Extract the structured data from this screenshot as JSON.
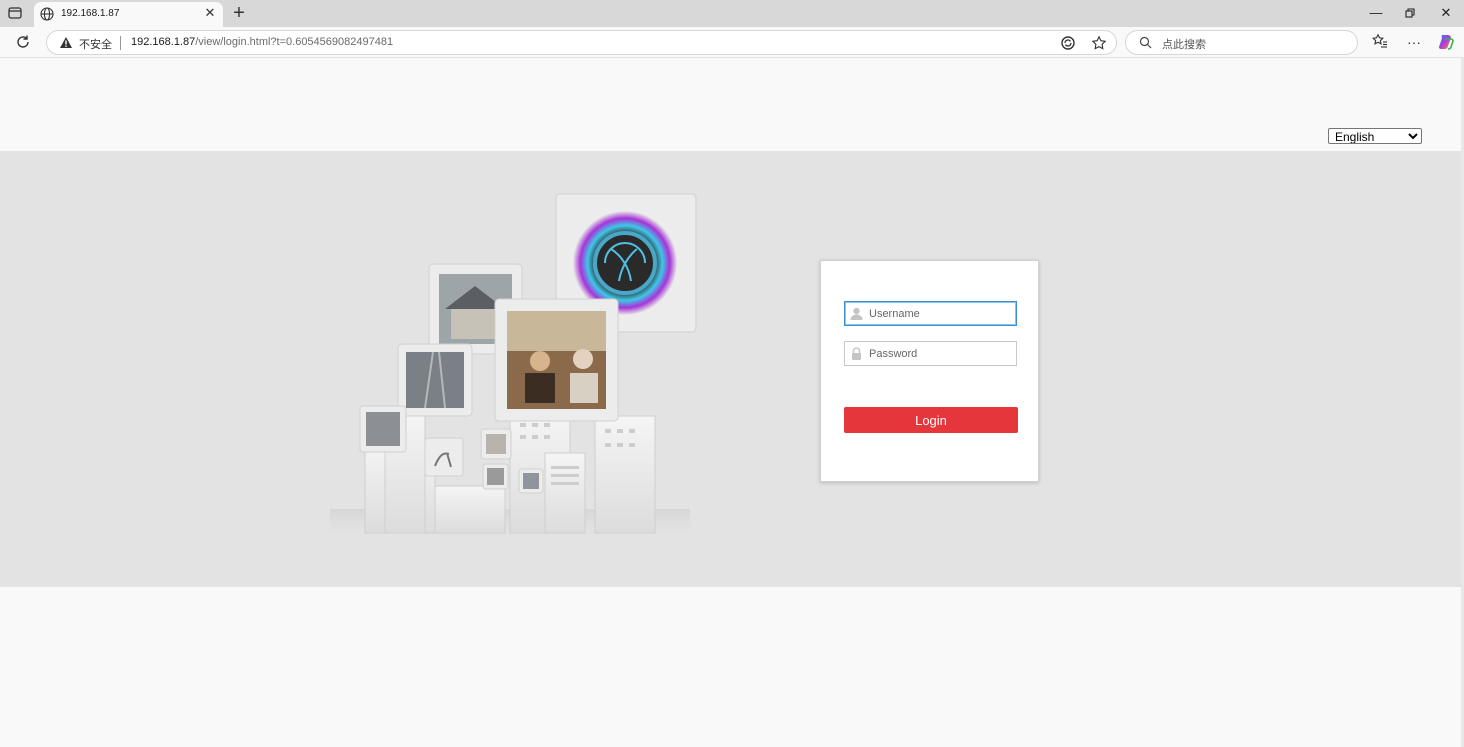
{
  "browser": {
    "tab_title": "192.168.1.87",
    "security_label": "不安全",
    "url_host": "192.168.1.87",
    "url_path": "/view/login.html?t=0.6054569082497481",
    "search_placeholder": "点此搜索"
  },
  "page": {
    "language": {
      "selected": "English",
      "options": [
        "English"
      ]
    },
    "login": {
      "username_placeholder": "Username",
      "password_placeholder": "Password",
      "button_label": "Login"
    }
  },
  "colors": {
    "accent": "#e5373b",
    "focus": "#3a8fd3",
    "band": "#e3e3e3"
  }
}
